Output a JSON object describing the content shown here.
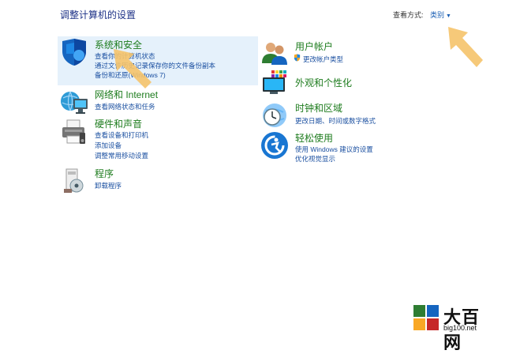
{
  "header": {
    "title": "调整计算机的设置",
    "view_by_label": "查看方式:",
    "view_by_value": "类别"
  },
  "left_categories": [
    {
      "title": "系统和安全",
      "links": [
        "查看你的计算机状态",
        "通过文件历史记录保存你的文件备份副本",
        "备份和还原(Windows 7)"
      ]
    },
    {
      "title": "网络和 Internet",
      "links": [
        "查看网络状态和任务"
      ]
    },
    {
      "title": "硬件和声音",
      "links": [
        "查看设备和打印机",
        "添加设备",
        "调整常用移动设置"
      ]
    },
    {
      "title": "程序",
      "links": [
        "卸载程序"
      ]
    }
  ],
  "right_categories": [
    {
      "title": "用户帐户",
      "links": [
        "更改帐户类型"
      ]
    },
    {
      "title": "外观和个性化",
      "links": []
    },
    {
      "title": "时钟和区域",
      "links": [
        "更改日期、时间或数字格式"
      ]
    },
    {
      "title": "轻松使用",
      "links": [
        "使用 Windows 建议的设置",
        "优化视觉显示"
      ]
    }
  ],
  "watermark": {
    "brand": "大百网",
    "url": "big100.net"
  },
  "colors": {
    "category_title": "#1e7c1e",
    "link": "#1a4fa0",
    "highlight": "#e5f1fb",
    "arrow": "#f5c36a"
  }
}
